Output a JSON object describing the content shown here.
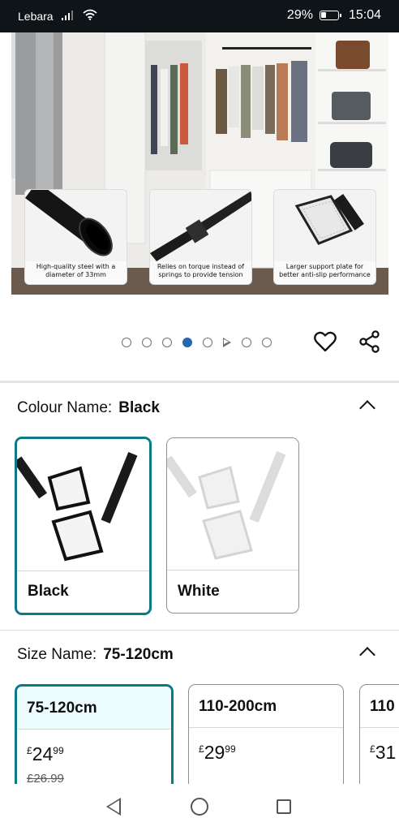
{
  "status_bar": {
    "carrier": "Lebara",
    "battery": "29%",
    "time": "15:04"
  },
  "hero": {
    "features": [
      {
        "caption": "High-quality steel with a diameter of 33mm"
      },
      {
        "caption": "Relies on torque instead of springs to provide tension"
      },
      {
        "caption": "Larger support plate for better anti-slip performance"
      }
    ]
  },
  "carousel": {
    "dot_count": 8,
    "active_index": 3
  },
  "colour": {
    "label": "Colour Name:",
    "value": "Black",
    "options": [
      {
        "label": "Black",
        "selected": true
      },
      {
        "label": "White",
        "selected": false
      }
    ]
  },
  "size": {
    "label": "Size Name:",
    "value": "75-120cm",
    "options": [
      {
        "label": "75-120cm",
        "currency": "£",
        "whole": "24",
        "fraction": "99",
        "was": "£26.99",
        "selected": true
      },
      {
        "label": "110-200cm",
        "currency": "£",
        "whole": "29",
        "fraction": "99",
        "selected": false
      },
      {
        "label": "110",
        "currency": "£",
        "whole": "31",
        "selected": false
      }
    ]
  },
  "colors": {
    "accent": "#0b7a87",
    "dot_active": "#2467ad",
    "status_bg": "#0f1419"
  },
  "icons": [
    "wifi-icon",
    "signal-icon",
    "battery-icon",
    "heart-icon",
    "share-icon",
    "chevron-up-icon",
    "back-icon",
    "home-icon",
    "recents-icon"
  ]
}
